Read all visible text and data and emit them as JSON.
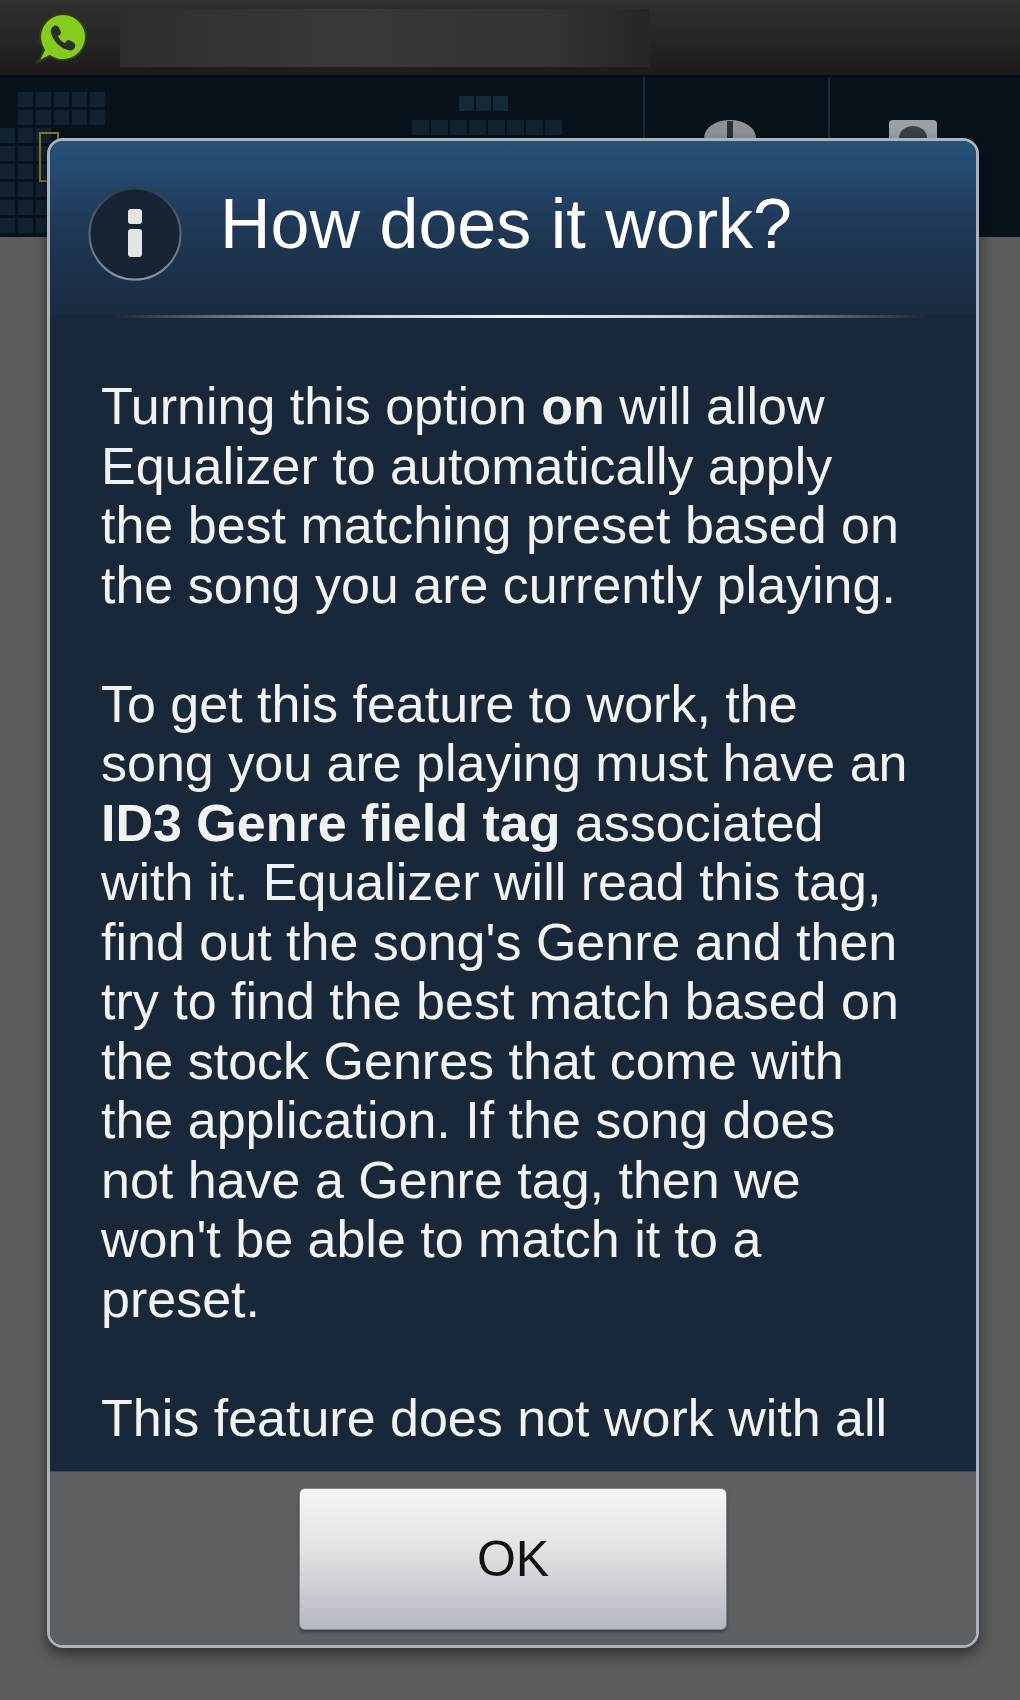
{
  "dialog": {
    "title": "How does it work?",
    "paragraphs": [
      "Turning this option **on** will allow Equalizer to automatically apply the best matching preset based on the song you are currently playing.",
      "To get this feature to work, the song you are playing must have an **ID3 Genre field tag** associated with it. Equalizer will read this tag, find out the song's Genre and then try to find the best match based on the stock Genres that come with the application. If the song does not have a Genre tag, then we won't be able to match it to a preset.",
      "This feature does not work with all"
    ],
    "buttons": [
      "OK"
    ]
  }
}
